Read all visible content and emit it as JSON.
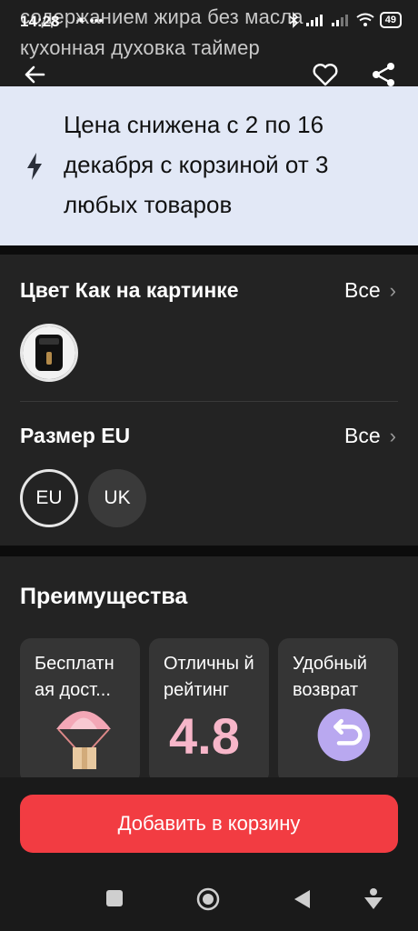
{
  "status_bar": {
    "time": "14:28",
    "left_icons": "❧ •••",
    "battery": "49"
  },
  "background_title": {
    "line1": "содержанием жира без масла",
    "line2": "кухонная духовка таймер"
  },
  "promo": {
    "text": "Цена снижена с 2 по 16 декабря с корзиной от 3 любых товаров",
    "bg_color": "#e2e8f6"
  },
  "color_option": {
    "title": "Цвет Как на картинке",
    "all_label": "Все"
  },
  "size_option": {
    "title": "Размер EU",
    "all_label": "Все",
    "values": [
      "EU",
      "UK"
    ],
    "selected": "EU"
  },
  "benefits": {
    "title": "Преимущества",
    "cards": [
      {
        "label": "Бесплатн ая дост...",
        "icon": "parachute-box-icon"
      },
      {
        "label": "Отличны й рейтинг",
        "icon": "rating-4-8-icon",
        "rating": "4.8"
      },
      {
        "label": "Удобный возврат",
        "icon": "return-arrow-icon"
      }
    ]
  },
  "cta": {
    "label": "Добавить в корзину",
    "color": "#f23c42"
  }
}
